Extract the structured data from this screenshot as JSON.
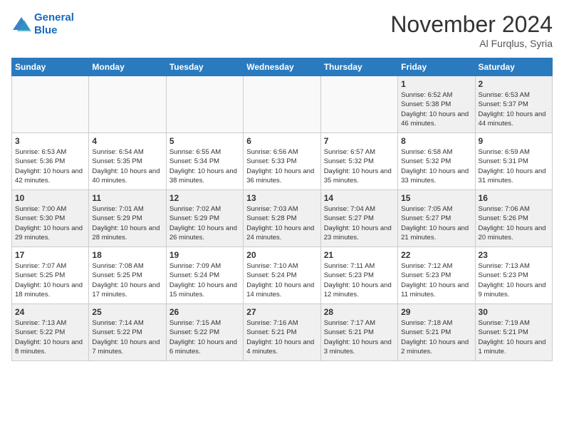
{
  "header": {
    "logo_line1": "General",
    "logo_line2": "Blue",
    "month": "November 2024",
    "location": "Al Furqlus, Syria"
  },
  "days_of_week": [
    "Sunday",
    "Monday",
    "Tuesday",
    "Wednesday",
    "Thursday",
    "Friday",
    "Saturday"
  ],
  "weeks": [
    [
      {
        "day": "",
        "empty": true
      },
      {
        "day": "",
        "empty": true
      },
      {
        "day": "",
        "empty": true
      },
      {
        "day": "",
        "empty": true
      },
      {
        "day": "",
        "empty": true
      },
      {
        "day": "1",
        "sunrise": "6:52 AM",
        "sunset": "5:38 PM",
        "daylight": "10 hours and 46 minutes."
      },
      {
        "day": "2",
        "sunrise": "6:53 AM",
        "sunset": "5:37 PM",
        "daylight": "10 hours and 44 minutes."
      }
    ],
    [
      {
        "day": "3",
        "sunrise": "6:53 AM",
        "sunset": "5:36 PM",
        "daylight": "10 hours and 42 minutes."
      },
      {
        "day": "4",
        "sunrise": "6:54 AM",
        "sunset": "5:35 PM",
        "daylight": "10 hours and 40 minutes."
      },
      {
        "day": "5",
        "sunrise": "6:55 AM",
        "sunset": "5:34 PM",
        "daylight": "10 hours and 38 minutes."
      },
      {
        "day": "6",
        "sunrise": "6:56 AM",
        "sunset": "5:33 PM",
        "daylight": "10 hours and 36 minutes."
      },
      {
        "day": "7",
        "sunrise": "6:57 AM",
        "sunset": "5:32 PM",
        "daylight": "10 hours and 35 minutes."
      },
      {
        "day": "8",
        "sunrise": "6:58 AM",
        "sunset": "5:32 PM",
        "daylight": "10 hours and 33 minutes."
      },
      {
        "day": "9",
        "sunrise": "6:59 AM",
        "sunset": "5:31 PM",
        "daylight": "10 hours and 31 minutes."
      }
    ],
    [
      {
        "day": "10",
        "sunrise": "7:00 AM",
        "sunset": "5:30 PM",
        "daylight": "10 hours and 29 minutes."
      },
      {
        "day": "11",
        "sunrise": "7:01 AM",
        "sunset": "5:29 PM",
        "daylight": "10 hours and 28 minutes."
      },
      {
        "day": "12",
        "sunrise": "7:02 AM",
        "sunset": "5:29 PM",
        "daylight": "10 hours and 26 minutes."
      },
      {
        "day": "13",
        "sunrise": "7:03 AM",
        "sunset": "5:28 PM",
        "daylight": "10 hours and 24 minutes."
      },
      {
        "day": "14",
        "sunrise": "7:04 AM",
        "sunset": "5:27 PM",
        "daylight": "10 hours and 23 minutes."
      },
      {
        "day": "15",
        "sunrise": "7:05 AM",
        "sunset": "5:27 PM",
        "daylight": "10 hours and 21 minutes."
      },
      {
        "day": "16",
        "sunrise": "7:06 AM",
        "sunset": "5:26 PM",
        "daylight": "10 hours and 20 minutes."
      }
    ],
    [
      {
        "day": "17",
        "sunrise": "7:07 AM",
        "sunset": "5:25 PM",
        "daylight": "10 hours and 18 minutes."
      },
      {
        "day": "18",
        "sunrise": "7:08 AM",
        "sunset": "5:25 PM",
        "daylight": "10 hours and 17 minutes."
      },
      {
        "day": "19",
        "sunrise": "7:09 AM",
        "sunset": "5:24 PM",
        "daylight": "10 hours and 15 minutes."
      },
      {
        "day": "20",
        "sunrise": "7:10 AM",
        "sunset": "5:24 PM",
        "daylight": "10 hours and 14 minutes."
      },
      {
        "day": "21",
        "sunrise": "7:11 AM",
        "sunset": "5:23 PM",
        "daylight": "10 hours and 12 minutes."
      },
      {
        "day": "22",
        "sunrise": "7:12 AM",
        "sunset": "5:23 PM",
        "daylight": "10 hours and 11 minutes."
      },
      {
        "day": "23",
        "sunrise": "7:13 AM",
        "sunset": "5:23 PM",
        "daylight": "10 hours and 9 minutes."
      }
    ],
    [
      {
        "day": "24",
        "sunrise": "7:13 AM",
        "sunset": "5:22 PM",
        "daylight": "10 hours and 8 minutes."
      },
      {
        "day": "25",
        "sunrise": "7:14 AM",
        "sunset": "5:22 PM",
        "daylight": "10 hours and 7 minutes."
      },
      {
        "day": "26",
        "sunrise": "7:15 AM",
        "sunset": "5:22 PM",
        "daylight": "10 hours and 6 minutes."
      },
      {
        "day": "27",
        "sunrise": "7:16 AM",
        "sunset": "5:21 PM",
        "daylight": "10 hours and 4 minutes."
      },
      {
        "day": "28",
        "sunrise": "7:17 AM",
        "sunset": "5:21 PM",
        "daylight": "10 hours and 3 minutes."
      },
      {
        "day": "29",
        "sunrise": "7:18 AM",
        "sunset": "5:21 PM",
        "daylight": "10 hours and 2 minutes."
      },
      {
        "day": "30",
        "sunrise": "7:19 AM",
        "sunset": "5:21 PM",
        "daylight": "10 hours and 1 minute."
      }
    ]
  ]
}
